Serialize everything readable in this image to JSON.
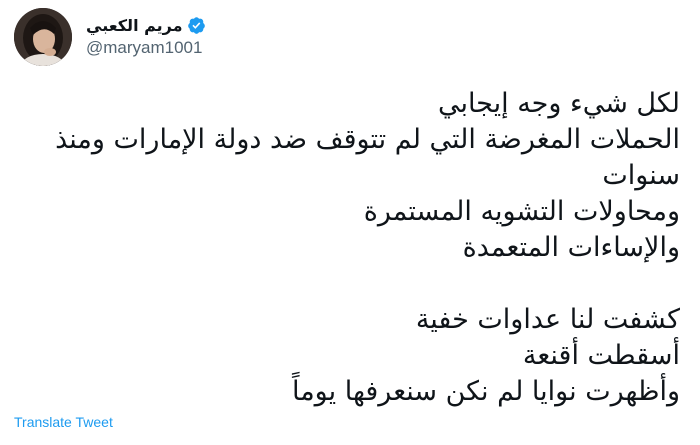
{
  "author": {
    "display_name": "مريم الكعبي",
    "handle": "@maryam1001",
    "verified": true,
    "avatar_icon": "profile-photo",
    "verified_icon": "verified-badge-icon",
    "accent_color": "#1d9bf0"
  },
  "tweet": {
    "lines": [
      "لكل شيء وجه إيجابي",
      "الحملات المغرضة التي لم تتوقف ضد دولة الإمارات ومنذ",
      "سنوات",
      "ومحاولات التشويه المستمرة",
      "والإساءات المتعمدة",
      "",
      "كشفت لنا عداوات خفية",
      "أسقطت أقنعة",
      "وأظهرت نوايا لم نكن سنعرفها يوماً"
    ]
  },
  "actions": {
    "translate_label": "Translate Tweet"
  }
}
